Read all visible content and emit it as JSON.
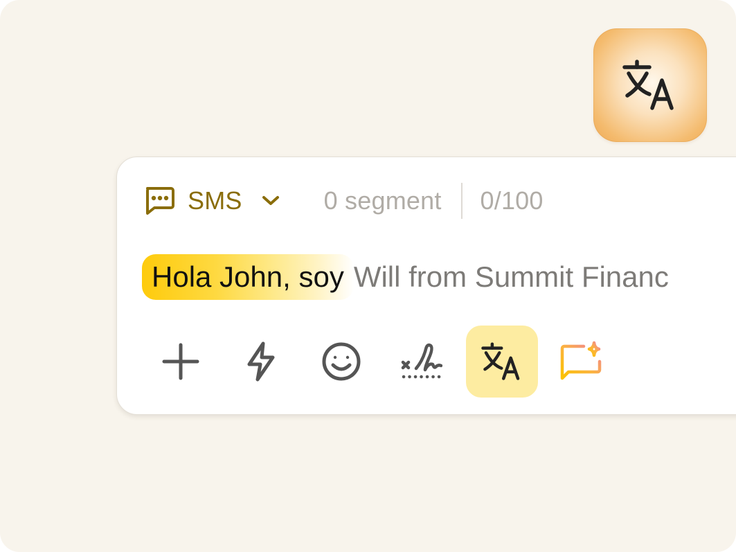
{
  "badge": {
    "icon": "translate-icon"
  },
  "composer": {
    "channel": {
      "icon": "message-icon",
      "label": "SMS",
      "dropdown_icon": "chevron-down-icon"
    },
    "segments": "0 segment",
    "char_count": "0/100",
    "message": {
      "translated_text": "Hola John, soy",
      "original_text": " Will from Summit Financ"
    },
    "toolbar": [
      {
        "name": "add",
        "icon": "plus-icon"
      },
      {
        "name": "quick-actions",
        "icon": "lightning-icon"
      },
      {
        "name": "emoji",
        "icon": "smiley-icon"
      },
      {
        "name": "signature",
        "icon": "signature-icon"
      },
      {
        "name": "translate",
        "icon": "translate-icon",
        "active": true
      },
      {
        "name": "ai-compose",
        "icon": "ai-sparkle-icon"
      }
    ]
  },
  "colors": {
    "background": "#f8f4ec",
    "accent": "#8a6d0a",
    "highlight": "#fecb0c",
    "active_tool": "#fdeca1",
    "muted_text": "#b0aca6",
    "icon": "#555555"
  }
}
